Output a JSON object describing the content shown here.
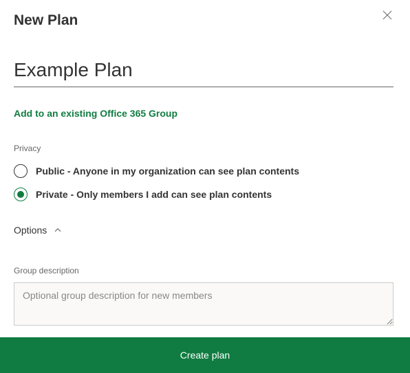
{
  "dialog": {
    "title": "New Plan",
    "plan_name_value": "Example Plan",
    "add_group_link": "Add to an existing Office 365 Group",
    "privacy_label": "Privacy",
    "privacy_options": [
      {
        "label": "Public - Anyone in my organization can see plan contents",
        "selected": false
      },
      {
        "label": "Private - Only members I add can see plan contents",
        "selected": true
      }
    ],
    "options_toggle_label": "Options",
    "group_desc_label": "Group description",
    "group_desc_placeholder": "Optional group description for new members",
    "group_desc_value": "",
    "create_button_label": "Create plan"
  },
  "colors": {
    "accent": "#107c41"
  }
}
